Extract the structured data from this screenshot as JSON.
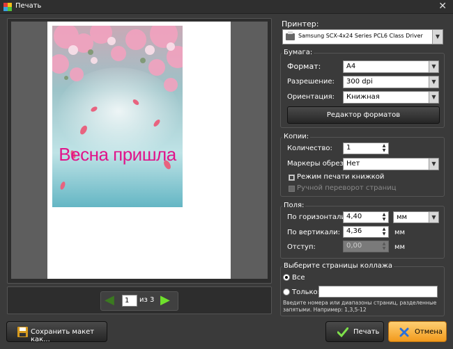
{
  "window": {
    "title": "Печать",
    "close_glyph": "✕"
  },
  "preview": {
    "photo_text": "Весна пришла",
    "pager": {
      "current_page": "1",
      "of_label": "из 3"
    }
  },
  "printer": {
    "label": "Принтер:",
    "selected": "Samsung SCX-4x24 Series PCL6 Class Driver"
  },
  "paper": {
    "title": "Бумага:",
    "format_label": "Формат:",
    "format_value": "A4",
    "resolution_label": "Разрешение:",
    "resolution_value": "300 dpi",
    "orientation_label": "Ориентация:",
    "orientation_value": "Книжная",
    "format_editor_button": "Редактор форматов"
  },
  "copies": {
    "title": "Копии:",
    "count_label": "Количество:",
    "count_value": "1",
    "crop_marks_label": "Маркеры обрезки:",
    "crop_marks_value": "Нет",
    "booklet_label": "Режим печати книжкой",
    "booklet_checked": true,
    "manual_flip_label": "Ручной переворот страниц",
    "manual_flip_enabled": false
  },
  "margins": {
    "title": "Поля:",
    "horizontal_label": "По горизонтали:",
    "horizontal_value": "4,40",
    "unit_select": "мм",
    "vertical_label": "По вертикали:",
    "vertical_value": "4,36",
    "vertical_unit": "мм",
    "indent_label": "Отступ:",
    "indent_value": "0,00",
    "indent_unit": "мм"
  },
  "collage_pages": {
    "title": "Выберите страницы коллажа",
    "all_label": "Все",
    "only_label": "Только:",
    "only_value": "",
    "hint": "Введите номера или диапазоны страниц, разделенные запятыми. Например: 1,3,5-12"
  },
  "buttons": {
    "save_layout": "Сохранить макет как...",
    "print": "Печать",
    "cancel": "Отмена"
  },
  "colors": {
    "accent_orange": "#f29a1c",
    "print_check": "#7ee04a",
    "cancel_x": "#2a6fdb",
    "photo_text": "#e0148a"
  },
  "icons": {
    "app": "app-icon",
    "printer": "printer-icon",
    "prev": "arrow-left-icon",
    "next": "arrow-right-icon",
    "save": "floppy-disk-icon",
    "print": "checkmark-icon",
    "cancel": "x-icon"
  }
}
